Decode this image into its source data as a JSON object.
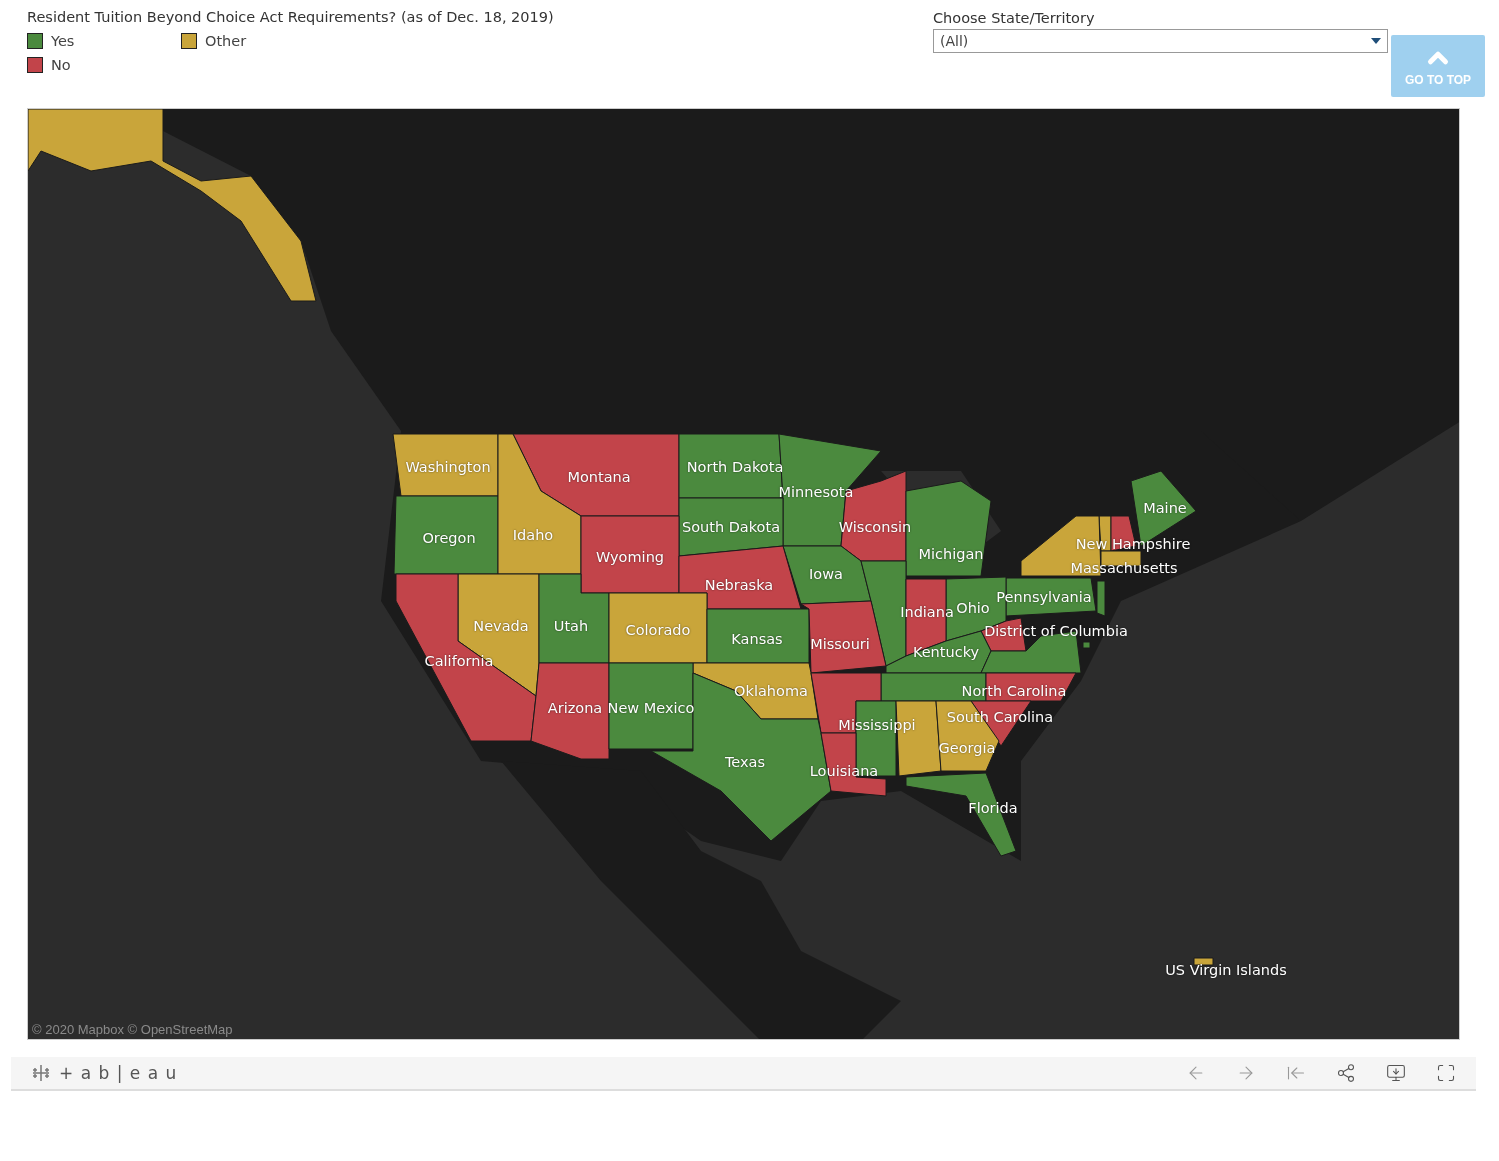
{
  "title": "Resident Tuition Beyond Choice Act Requirements? (as of Dec. 18, 2019)",
  "legend": [
    {
      "label": "Yes",
      "color": "#4b8a3e"
    },
    {
      "label": "Other",
      "color": "#c9a53a"
    },
    {
      "label": "No",
      "color": "#c2444a"
    }
  ],
  "filter": {
    "label": "Choose State/Territory",
    "value": "(All)"
  },
  "go_to_top": "GO TO TOP",
  "map": {
    "attribution": "© 2020 Mapbox  © OpenStreetMap",
    "states": [
      {
        "color": "#c9a53a"
      },
      {
        "label": "Washington",
        "color": "#c9a53a"
      },
      {
        "label": "Montana",
        "color": "#c2444a"
      },
      {
        "label": "North Dakota",
        "color": "#4b8a3e"
      },
      {
        "label": "Minnesota",
        "color": "#4b8a3e"
      },
      {
        "label": "Maine",
        "color": "#4b8a3e"
      },
      {
        "label": "South Dakota",
        "color": "#4b8a3e"
      },
      {
        "label": "Wisconsin",
        "color": "#c2444a"
      },
      {
        "color": "#c9a53a"
      },
      {
        "label": "Oregon",
        "color": "#4b8a3e"
      },
      {
        "label": "Idaho",
        "color": "#c9a53a"
      },
      {
        "label": "New Hampshire",
        "color": "#c2444a"
      },
      {
        "color": "#c9a53a"
      },
      {
        "label": "Michigan",
        "color": "#4b8a3e"
      },
      {
        "label": "Wyoming",
        "color": "#c2444a"
      },
      {
        "label": "Massachusetts",
        "color": "#c9a53a"
      },
      {
        "label": "Iowa",
        "color": "#4b8a3e"
      },
      {
        "label": "Nebraska",
        "color": "#c2444a"
      },
      {
        "label": "Pennsylvania",
        "color": "#4b8a3e"
      },
      {
        "color": "#4b8a3e"
      },
      {
        "label": "Ohio",
        "color": "#4b8a3e"
      },
      {
        "color": "#4b8a3e"
      },
      {
        "label": "Indiana",
        "color": "#c2444a"
      },
      {
        "label": "Nevada",
        "color": "#c9a53a"
      },
      {
        "label": "Utah",
        "color": "#4b8a3e"
      },
      {
        "label": "Colorado",
        "color": "#c9a53a"
      },
      {
        "label": "District of Columbia",
        "color": "#4b8a3e"
      },
      {
        "color": "#c2444a"
      },
      {
        "label": "Kansas",
        "color": "#4b8a3e"
      },
      {
        "label": "Missouri",
        "color": "#c2444a"
      },
      {
        "label": "Kentucky",
        "color": "#4b8a3e"
      },
      {
        "color": "#4b8a3e"
      },
      {
        "label": "California",
        "color": "#c2444a"
      },
      {
        "color": "#4b8a3e"
      },
      {
        "label": "Oklahoma",
        "color": "#c9a53a"
      },
      {
        "label": "North Carolina",
        "color": "#c2444a"
      },
      {
        "color": "#c2444a"
      },
      {
        "label": "Arizona",
        "color": "#c2444a"
      },
      {
        "label": "New Mexico",
        "color": "#4b8a3e"
      },
      {
        "label": "South Carolina",
        "color": "#c2444a"
      },
      {
        "label": "Mississippi",
        "color": "#4b8a3e"
      },
      {
        "color": "#c9a53a"
      },
      {
        "label": "Georgia",
        "color": "#c9a53a"
      },
      {
        "label": "Texas",
        "color": "#4b8a3e"
      },
      {
        "label": "Louisiana",
        "color": "#c2444a"
      },
      {
        "label": "Florida",
        "color": "#4b8a3e"
      },
      {
        "label": "US Virgin Islands",
        "color": "#c9a53a"
      }
    ]
  },
  "toolbar": {
    "logo": "+ a b | e a u"
  }
}
